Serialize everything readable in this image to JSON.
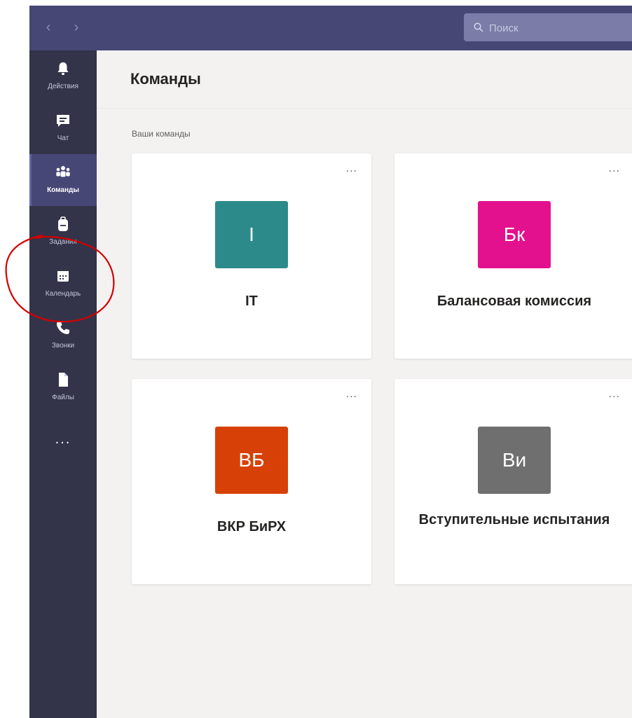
{
  "search": {
    "placeholder": "Поиск"
  },
  "sidebar": {
    "items": [
      {
        "label": "Действия"
      },
      {
        "label": "Чат"
      },
      {
        "label": "Команды"
      },
      {
        "label": "Задания"
      },
      {
        "label": "Календарь"
      },
      {
        "label": "Звонки"
      },
      {
        "label": "Файлы"
      }
    ],
    "more_label": "..."
  },
  "main": {
    "title": "Команды",
    "section_label": "Ваши команды",
    "teams": [
      {
        "initials": "I",
        "name": "IT",
        "color": "#2c8b8a"
      },
      {
        "initials": "Бк",
        "name": "Балансовая комиссия",
        "color": "#e3118e"
      },
      {
        "initials": "ВБ",
        "name": "ВКР БиРХ",
        "color": "#d74108"
      },
      {
        "initials": "Ви",
        "name": "Вступительные испытания",
        "color": "#6f6f6f"
      }
    ],
    "more_label": "..."
  },
  "colors": {
    "topbar": "#464775",
    "rail": "#33344a",
    "annotation": "#d40000"
  }
}
